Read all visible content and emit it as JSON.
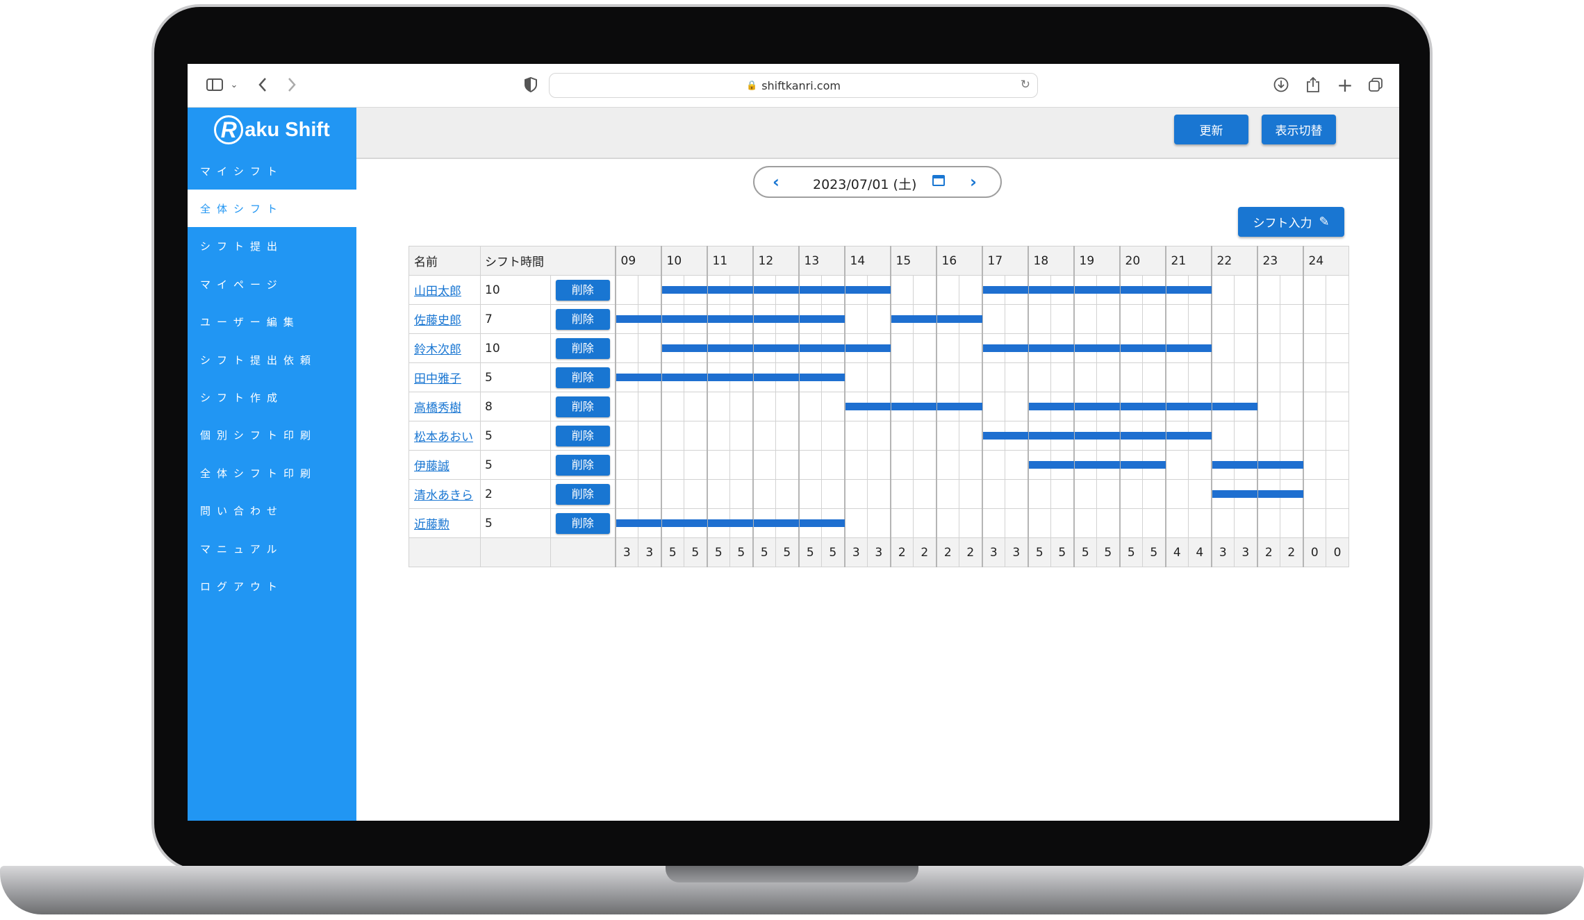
{
  "browser": {
    "url": "shiftkanri.com"
  },
  "sidebar": {
    "logo": "Raku Shift",
    "logo_initial": "R",
    "logo_rest": "aku Shift",
    "items": [
      {
        "label": "マイシフト",
        "active": false
      },
      {
        "label": "全体シフト",
        "active": true
      },
      {
        "label": "シフト提出",
        "active": false
      },
      {
        "label": "マイページ",
        "active": false
      },
      {
        "label": "ユーザー編集",
        "active": false
      },
      {
        "label": "シフト提出依頼",
        "active": false
      },
      {
        "label": "シフト作成",
        "active": false
      },
      {
        "label": "個別シフト印刷",
        "active": false
      },
      {
        "label": "全体シフト印刷",
        "active": false
      },
      {
        "label": "問い合わせ",
        "active": false
      },
      {
        "label": "マニュアル",
        "active": false
      },
      {
        "label": "ログアウト",
        "active": false
      }
    ]
  },
  "header": {
    "refresh_label": "更新",
    "toggle_label": "表示切替"
  },
  "date_nav": {
    "date": "2023/07/01 (土)"
  },
  "shift_input_label": "シフト入力",
  "table": {
    "col_name": "名前",
    "col_time": "シフト時間",
    "delete_label": "削除",
    "hours": [
      "09",
      "10",
      "11",
      "12",
      "13",
      "14",
      "15",
      "16",
      "17",
      "18",
      "19",
      "20",
      "21",
      "22",
      "23",
      "24"
    ],
    "rows": [
      {
        "name": "山田太郎",
        "hours": "10",
        "shifts": [
          [
            10,
            15
          ],
          [
            17,
            22
          ]
        ]
      },
      {
        "name": "佐藤史郎",
        "hours": "7",
        "shifts": [
          [
            9,
            14
          ],
          [
            15,
            17
          ]
        ]
      },
      {
        "name": "鈴木次郎",
        "hours": "10",
        "shifts": [
          [
            10,
            15
          ],
          [
            17,
            22
          ]
        ]
      },
      {
        "name": "田中雅子",
        "hours": "5",
        "shifts": [
          [
            9,
            14
          ]
        ]
      },
      {
        "name": "高橋秀樹",
        "hours": "8",
        "shifts": [
          [
            14,
            17
          ],
          [
            18,
            23
          ]
        ]
      },
      {
        "name": "松本あおい",
        "hours": "5",
        "shifts": [
          [
            17,
            22
          ]
        ]
      },
      {
        "name": "伊藤誠",
        "hours": "5",
        "shifts": [
          [
            18,
            21
          ],
          [
            22,
            24
          ]
        ]
      },
      {
        "name": "清水あきら",
        "hours": "2",
        "shifts": [
          [
            22,
            24
          ]
        ]
      },
      {
        "name": "近藤勲",
        "hours": "5",
        "shifts": [
          [
            9,
            14
          ]
        ]
      }
    ],
    "counts": [
      "3",
      "3",
      "5",
      "5",
      "5",
      "5",
      "5",
      "5",
      "5",
      "5",
      "3",
      "3",
      "2",
      "2",
      "2",
      "2",
      "3",
      "3",
      "5",
      "5",
      "5",
      "5",
      "5",
      "5",
      "4",
      "4",
      "3",
      "3",
      "2",
      "2",
      "0",
      "0"
    ]
  }
}
